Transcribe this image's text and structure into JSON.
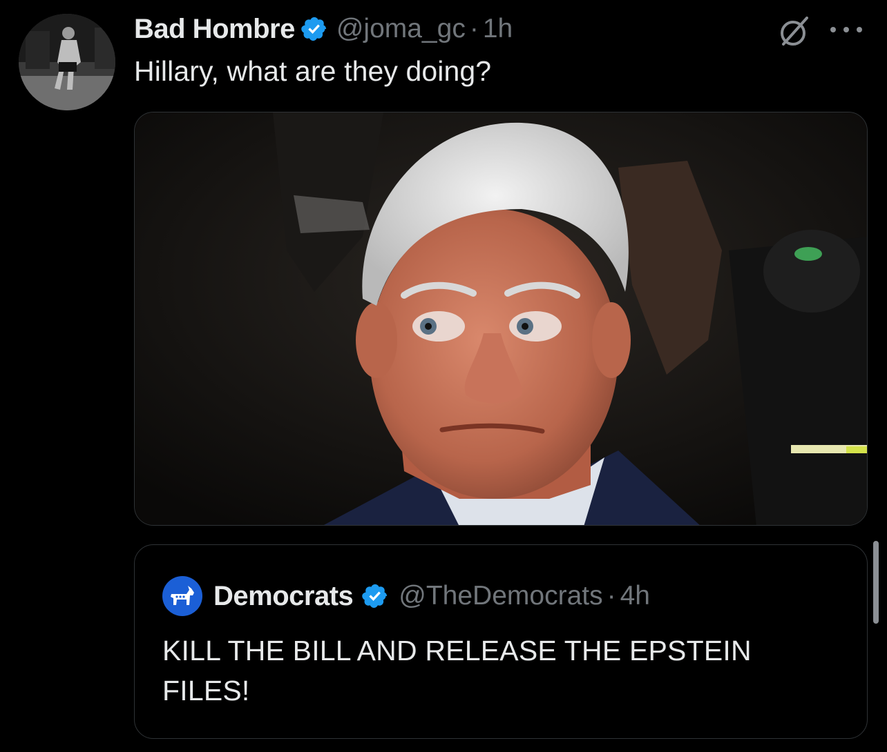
{
  "tweet": {
    "author": {
      "display_name": "Bad Hombre",
      "handle": "@joma_gc",
      "verified": true,
      "avatar_icon": "avatar-photo"
    },
    "separator": "·",
    "time": "1h",
    "text": "Hillary, what are they doing?",
    "media": {
      "type": "photo"
    },
    "actions": {
      "grok_icon": "grok-icon",
      "more_icon": "more-icon"
    }
  },
  "quoted_tweet": {
    "author": {
      "display_name": "Democrats",
      "handle": "@TheDemocrats",
      "verified": true,
      "avatar_icon": "donkey-icon"
    },
    "separator": "·",
    "time": "4h",
    "text": "KILL THE BILL AND RELEASE THE EPSTEIN FILES!"
  },
  "colors": {
    "background": "#000000",
    "primary_text": "#e7e9ea",
    "secondary_text": "#71767b",
    "verified_blue": "#1d9bf0",
    "border": "#2f3336",
    "dem_blue": "#1b5fd6"
  }
}
